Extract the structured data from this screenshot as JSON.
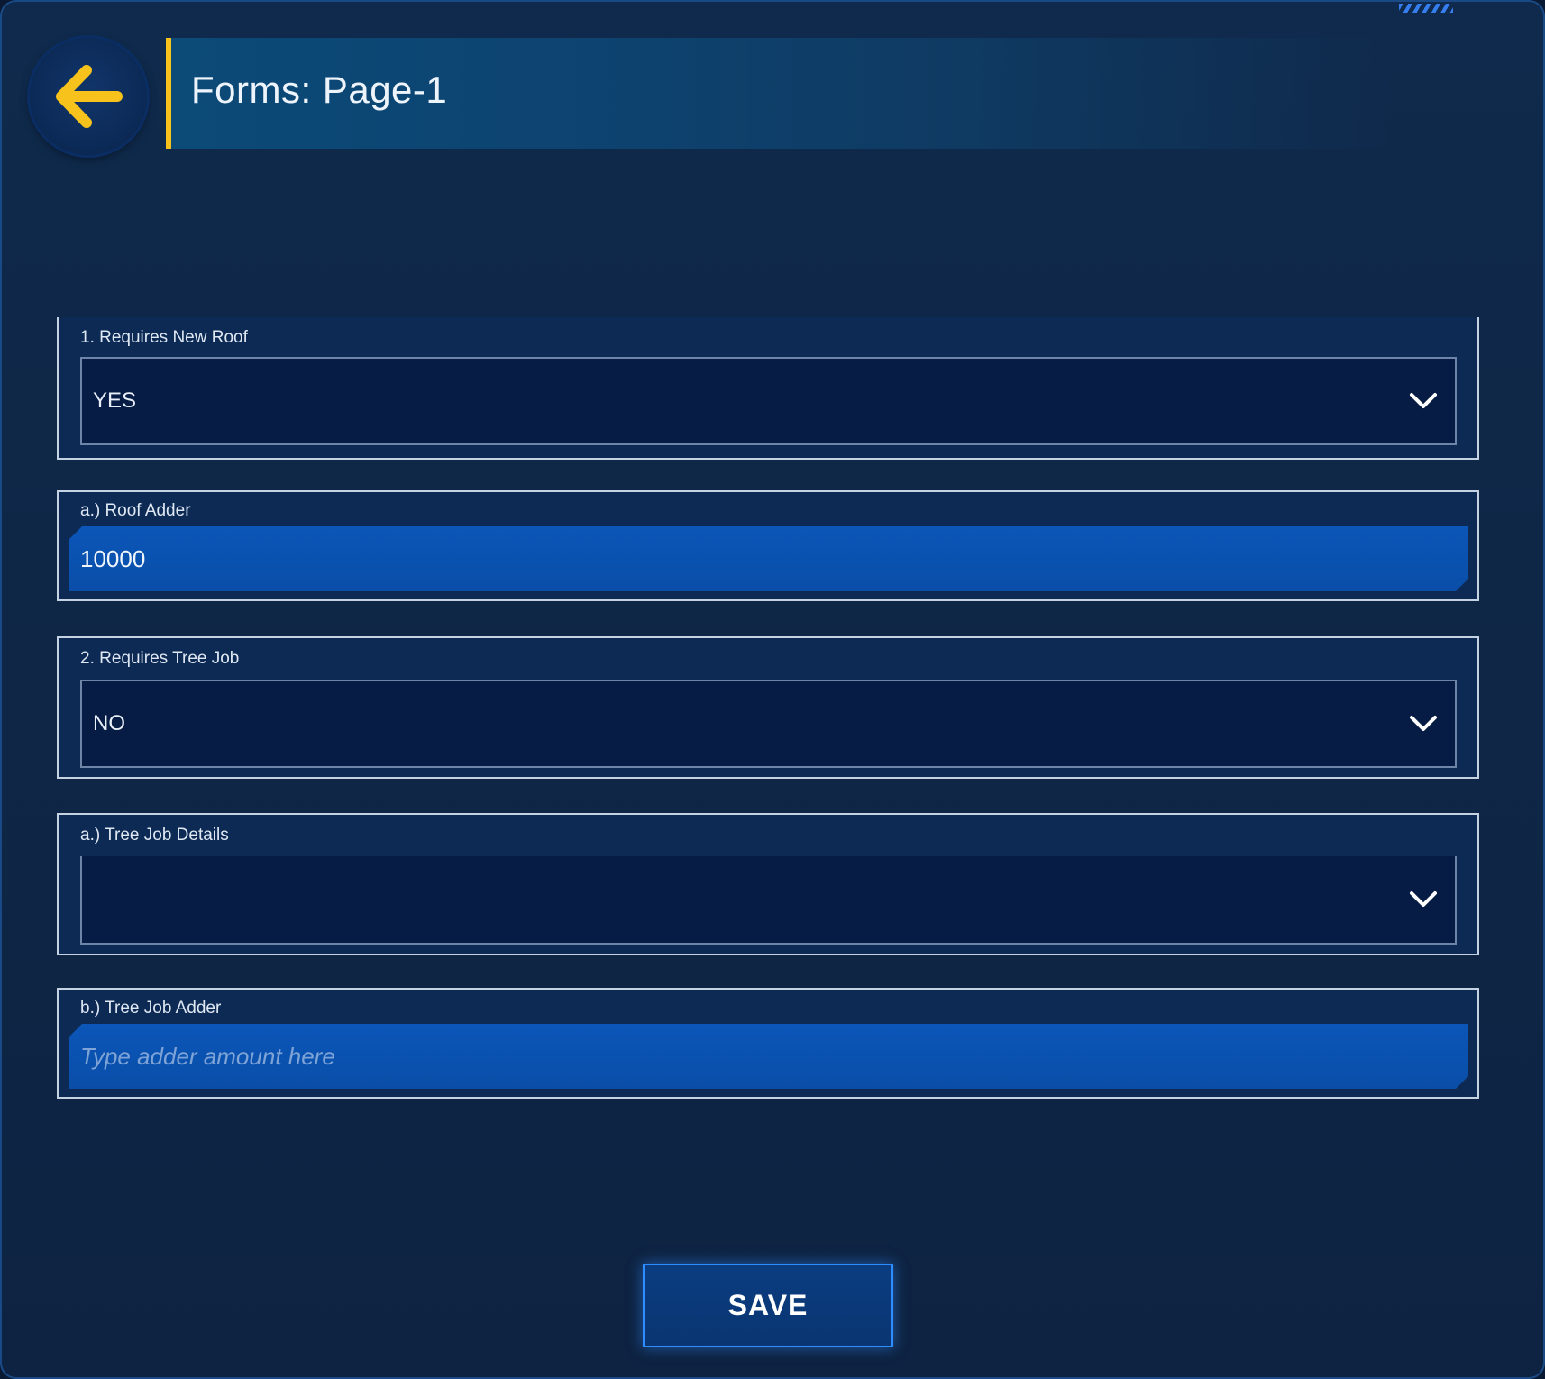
{
  "header": {
    "title": "Forms: Page-1",
    "back_icon": "arrow-left-icon",
    "accent_color": "#f6c21b"
  },
  "form": {
    "requires_new_roof": {
      "label": "1. Requires New Roof",
      "value": "YES"
    },
    "roof_adder": {
      "label": "a.) Roof Adder",
      "value": "10000",
      "placeholder": ""
    },
    "requires_tree_job": {
      "label": "2. Requires Tree Job",
      "value": "NO"
    },
    "tree_job_details": {
      "label": "a.) Tree Job Details",
      "value": ""
    },
    "tree_job_adder": {
      "label": "b.) Tree Job Adder",
      "value": "",
      "placeholder": "Type adder amount here"
    }
  },
  "actions": {
    "save_label": "SAVE"
  },
  "colors": {
    "input_fill": "#0b56b8",
    "select_fill": "#061c44",
    "button_glow": "#2f8dff"
  }
}
